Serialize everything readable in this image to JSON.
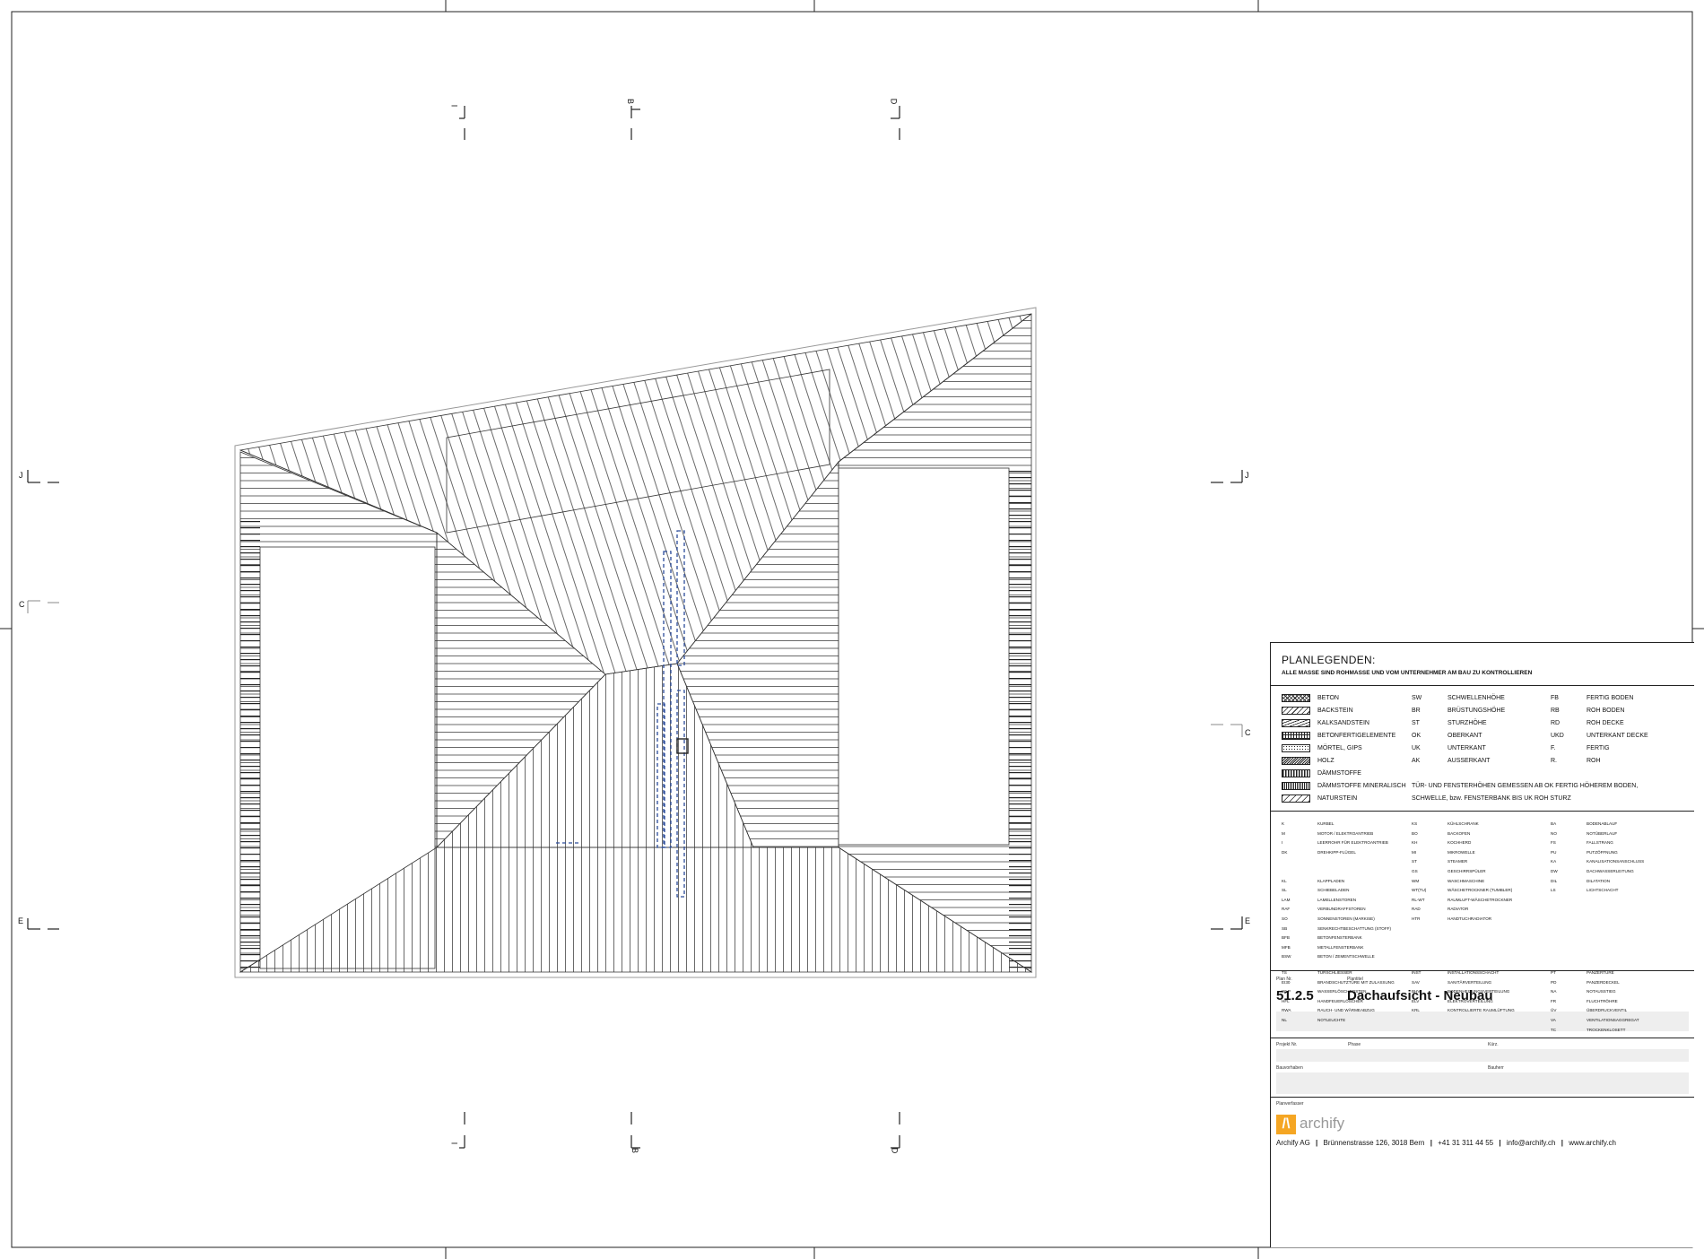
{
  "grid_markers": {
    "top": [
      "I",
      "B",
      "D"
    ],
    "bottom": [
      "I",
      "B",
      "D"
    ],
    "left": [
      "J",
      "C",
      "E"
    ],
    "right": [
      "J",
      "C",
      "E"
    ]
  },
  "legend": {
    "title": "PLANLEGENDEN:",
    "subtitle": "ALLE MASSE SIND ROHMASSE UND VOM UNTERNEHMER AM BAU ZU KONTROLLIEREN",
    "materials": [
      "BETON",
      "BACKSTEIN",
      "KALKSANDSTEIN",
      "BETONFERTIGELEMENTE",
      "MÖRTEL, GIPS",
      "HOLZ",
      "DÄMMSTOFFE",
      "DÄMMSTOFFE MINERALISCH",
      "NATURSTEIN"
    ],
    "heights_abbr": [
      {
        "code": "SW",
        "label": "SCHWELLENHÖHE"
      },
      {
        "code": "BR",
        "label": "BRÜSTUNGSHÖHE"
      },
      {
        "code": "ST",
        "label": "STURZHÖHE"
      },
      {
        "code": "OK",
        "label": "OBERKANT"
      },
      {
        "code": "UK",
        "label": "UNTERKANT"
      },
      {
        "code": "AK",
        "label": "AUSSERKANT"
      }
    ],
    "floor_abbr": [
      {
        "code": "FB",
        "label": "FERTIG BODEN"
      },
      {
        "code": "RB",
        "label": "ROH BODEN"
      },
      {
        "code": "RD",
        "label": "ROH DECKE"
      },
      {
        "code": "UKD",
        "label": "UNTERKANT DECKE"
      },
      {
        "code": "F.",
        "label": "FERTIG"
      },
      {
        "code": "R.",
        "label": "ROH"
      }
    ],
    "note_line1": "TÜR- UND FENSTERHÖHEN GEMESSEN AB OK FERTIG HÖHEREM BODEN,",
    "note_line2": "SCHWELLE, bzw. FENSTERBANK BIS UK ROH STURZ",
    "abbr_col1": [
      {
        "code": "K",
        "label": "KURBEL"
      },
      {
        "code": "M",
        "label": "MOTOR / ELEKTROANTRIEB"
      },
      {
        "code": "I",
        "label": "LEERROHR FÜR ELEKTROANTRIEB"
      },
      {
        "code": "DK",
        "label": "DREHKIPP-FLÜGEL"
      },
      {
        "code": "",
        "label": ""
      },
      {
        "code": "",
        "label": ""
      },
      {
        "code": "KL",
        "label": "KLAPPLADEN"
      },
      {
        "code": "SL",
        "label": "SCHIEBELADEN"
      },
      {
        "code": "LAM",
        "label": "LAMELLENSTOREN"
      },
      {
        "code": "RAF",
        "label": "VERBUNDRAFFSTOREN"
      },
      {
        "code": "SO",
        "label": "SONNENSTOREN (MARKISE)"
      },
      {
        "code": "SB",
        "label": "SENKRECHTBESCHATTUNG (STOFF)"
      },
      {
        "code": "BFB",
        "label": "BETONFENSTERBANK"
      },
      {
        "code": "MFB",
        "label": "METALLFENSTERBANK"
      },
      {
        "code": "BSW",
        "label": "BETON / ZEMENTSCHWELLE"
      }
    ],
    "abbr_col2": [
      {
        "code": "KS",
        "label": "KÜHLSCHRANK"
      },
      {
        "code": "BO",
        "label": "BACKOFEN"
      },
      {
        "code": "KH",
        "label": "KOCHHERD"
      },
      {
        "code": "MI",
        "label": "MIKROWELLE"
      },
      {
        "code": "ST",
        "label": "STEAMER"
      },
      {
        "code": "GS",
        "label": "GESCHIRRSPÜLER"
      },
      {
        "code": "WM",
        "label": "WASCHMASCHINE"
      },
      {
        "code": "WT(TU)",
        "label": "WÄSCHETROCKNER (TUMBLER)"
      },
      {
        "code": "RL-WT",
        "label": "RAUMLUFT-WÄSCHETROCKNER"
      },
      {
        "code": "RAD",
        "label": "RADIATOR"
      },
      {
        "code": "HTR",
        "label": "HANDTUCHRADIATOR"
      }
    ],
    "abbr_col3": [
      {
        "code": "BA",
        "label": "BODENABLAUF"
      },
      {
        "code": "NO",
        "label": "NOTÜBERLAUF"
      },
      {
        "code": "FS",
        "label": "FALLSTRANG"
      },
      {
        "code": "PU",
        "label": "PUTZÖFFNUNG"
      },
      {
        "code": "KA",
        "label": "KANALISATIONSANSCHLUSS"
      },
      {
        "code": "DW",
        "label": "DACHWASSERLEITUNG"
      },
      {
        "code": "DIL",
        "label": "DILATATION"
      },
      {
        "code": "LS",
        "label": "LICHTSCHACHT"
      }
    ],
    "abbr2_col1": [
      {
        "code": "TS",
        "label": "TÜRSCHLIESSER"
      },
      {
        "code": "EI30",
        "label": "BRANDSCHUTZTÜRE MIT ZULASSUNG"
      },
      {
        "code": "WLP",
        "label": "WASSERLÖSCHPOSTEN"
      },
      {
        "code": "HFL",
        "label": "HANDFEUERLÖSCHER"
      },
      {
        "code": "RWA",
        "label": "RAUCH- UND WÄRMEABZUG"
      },
      {
        "code": "NL",
        "label": "NOTLEUCHTE"
      }
    ],
    "abbr2_col2": [
      {
        "code": "INST",
        "label": "INSTALLATIONSSCHACHT"
      },
      {
        "code": "SAV",
        "label": "SANITÄRVERTEILUNG"
      },
      {
        "code": "BHV",
        "label": "BODENHEIZUNGSVERTEILUNG"
      },
      {
        "code": "ELV",
        "label": "ELEKTROVERTEILUNG"
      },
      {
        "code": "KRL",
        "label": "KONTROLLIERTE RAUMLÜFTUNG"
      }
    ],
    "abbr2_col3": [
      {
        "code": "PT",
        "label": "PANZERTÜRE"
      },
      {
        "code": "PD",
        "label": "PANZERDECKEL"
      },
      {
        "code": "NA",
        "label": "NOTAUSSTIEG"
      },
      {
        "code": "FR",
        "label": "FLUCHTRÖHRE"
      },
      {
        "code": "ÜV",
        "label": "ÜBERDRUCKVENTIL"
      },
      {
        "code": "VA",
        "label": "VENTILATIONSAGGREGAT"
      },
      {
        "code": "TC",
        "label": "TROCKENKLOSETT"
      }
    ]
  },
  "titleblock": {
    "plan_no_label": "Plan Nr.",
    "plan_title_label": "Plantitel",
    "plan_no": "51.2.5",
    "plan_title": "Dachaufsicht - Neubau",
    "project_no_label": "Projekt Nr.",
    "phase_label": "Phase",
    "kuerzel_label": "Kürz.",
    "client_label": "Bauvorhaben",
    "owner_label": "Bauherr",
    "author_label": "Planverfasser",
    "logo_glyph": "/\\",
    "logo_text": "archify",
    "company": "Archify AG",
    "address": "Brünnenstrasse 126, 3018 Bern",
    "phone": "+41 31 311 44 55",
    "email": "info@archify.ch",
    "web": "www.archify.ch",
    "separator": "|"
  },
  "colors": {
    "lines": "#222222",
    "hatch": "#444444",
    "installation_dashed": "#2b4c9a",
    "logo_accent": "#f5a623"
  }
}
